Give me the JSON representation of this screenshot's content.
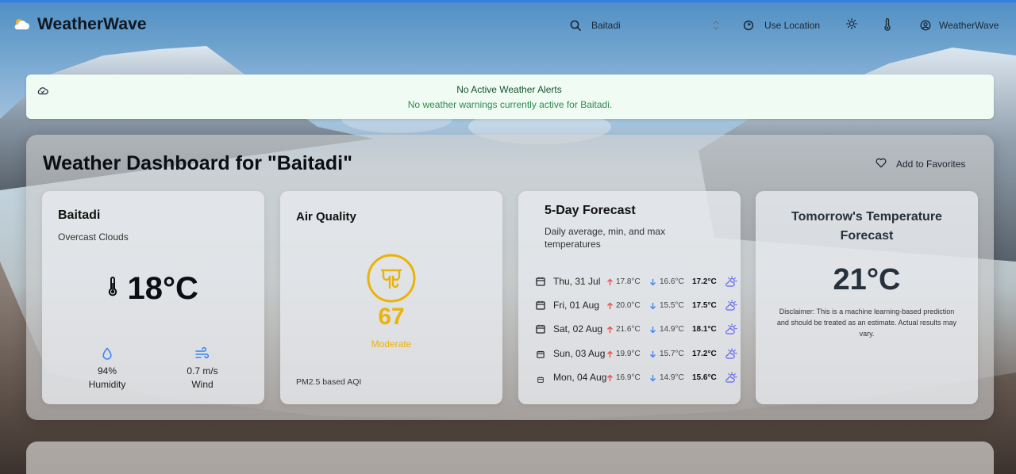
{
  "app": {
    "name": "WeatherWave"
  },
  "header": {
    "search_value": "Baitadi",
    "use_location_label": "Use Location",
    "user_label": "WeatherWave"
  },
  "alert": {
    "title": "No Active Weather Alerts",
    "description": "No weather warnings currently active for Baitadi."
  },
  "dashboard": {
    "title": "Weather Dashboard for \"Baitadi\"",
    "favorite_label": "Add to Favorites"
  },
  "current": {
    "city": "Baitadi",
    "condition": "Overcast Clouds",
    "temperature": "18°C",
    "humidity_value": "94%",
    "humidity_label": "Humidity",
    "wind_value": "0.7 m/s",
    "wind_label": "Wind"
  },
  "air_quality": {
    "title": "Air Quality",
    "value": "67",
    "level": "Moderate",
    "footnote": "PM2.5 based AQI"
  },
  "forecast": {
    "title": "5-Day Forecast",
    "subtitle": "Daily average, min, and max temperatures",
    "days": [
      {
        "day": "Thu, 31 Jul",
        "max": "17.8°C",
        "min": "16.6°C",
        "avg": "17.2°C"
      },
      {
        "day": "Fri, 01 Aug",
        "max": "20.0°C",
        "min": "15.5°C",
        "avg": "17.5°C"
      },
      {
        "day": "Sat, 02 Aug",
        "max": "21.6°C",
        "min": "14.9°C",
        "avg": "18.1°C"
      },
      {
        "day": "Sun, 03 Aug",
        "max": "19.9°C",
        "min": "15.7°C",
        "avg": "17.2°C"
      },
      {
        "day": "Mon, 04 Aug",
        "max": "16.9°C",
        "min": "14.9°C",
        "avg": "15.6°C"
      }
    ]
  },
  "tomorrow": {
    "title": "Tomorrow's Temperature Forecast",
    "value": "21°C",
    "disclaimer": "Disclaimer: This is a machine learning-based prediction and should be treated as an estimate. Actual results may vary."
  },
  "colors": {
    "accent_yellow": "#eab308",
    "alert_green": "#2e8a4c",
    "up_red": "#ef4444",
    "down_blue": "#3b82f6",
    "weather_icon": "#6366f1"
  },
  "icons": {
    "logo": "partly-cloudy-icon",
    "search": "search-icon",
    "sort": "chevron-up-down-icon",
    "location": "locate-icon",
    "theme": "sun-icon",
    "units": "thermometer-icon",
    "user": "user-circle-icon",
    "alert": "cloud-check-icon",
    "favorite": "heart-icon",
    "humidity": "droplet-icon",
    "wind": "wind-icon",
    "air": "air-quality-icon",
    "calendar": "calendar-icon",
    "weather": "cloud-sun-icon"
  }
}
